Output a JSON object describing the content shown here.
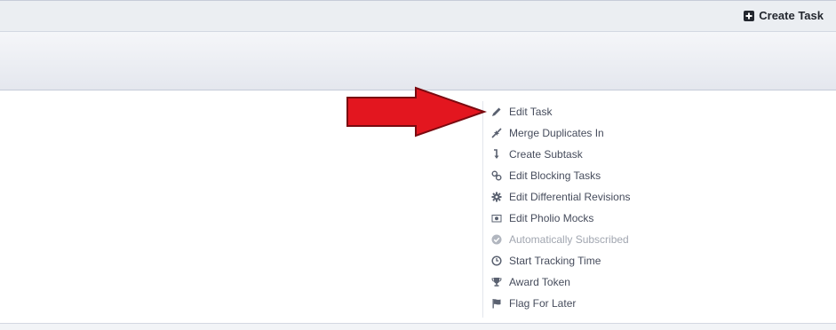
{
  "topbar": {
    "create_task_label": "Create Task"
  },
  "actions": [
    {
      "label": "Edit Task",
      "icon": "pencil-icon",
      "enabled": true
    },
    {
      "label": "Merge Duplicates In",
      "icon": "merge-icon",
      "enabled": true
    },
    {
      "label": "Create Subtask",
      "icon": "subtask-arrow-icon",
      "enabled": true
    },
    {
      "label": "Edit Blocking Tasks",
      "icon": "link-icon",
      "enabled": true
    },
    {
      "label": "Edit Differential Revisions",
      "icon": "gear-icon",
      "enabled": true
    },
    {
      "label": "Edit Pholio Mocks",
      "icon": "camera-icon",
      "enabled": true
    },
    {
      "label": "Automatically Subscribed",
      "icon": "check-circle-icon",
      "enabled": false
    },
    {
      "label": "Start Tracking Time",
      "icon": "clock-icon",
      "enabled": true
    },
    {
      "label": "Award Token",
      "icon": "trophy-icon",
      "enabled": true
    },
    {
      "label": "Flag For Later",
      "icon": "flag-icon",
      "enabled": true
    }
  ],
  "annotation": {
    "arrow_color": "#e3161f",
    "arrow_outline": "#7a0a10"
  }
}
